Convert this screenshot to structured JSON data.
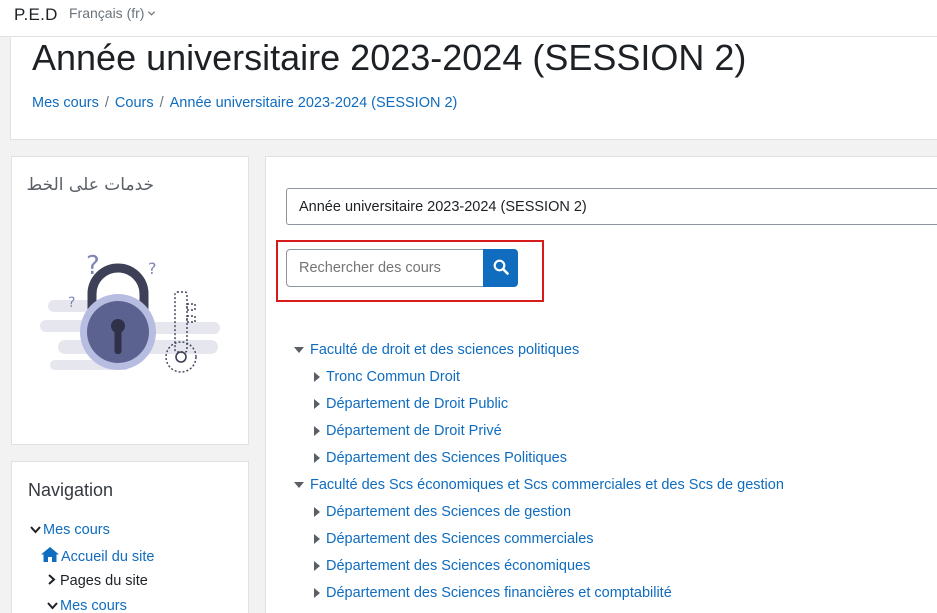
{
  "navbar": {
    "brand": "P.E.D",
    "language": "Français (fr)"
  },
  "header": {
    "title": "Année universitaire 2023-2024 (SESSION 2)",
    "breadcrumb": [
      "Mes cours",
      "Cours",
      "Année universitaire 2023-2024 (SESSION 2)"
    ]
  },
  "online_block": {
    "title": "خدمات على الخط"
  },
  "navigation": {
    "title": "Navigation",
    "items": [
      {
        "label": "Mes cours"
      },
      {
        "label": "Accueil du site"
      },
      {
        "label": "Pages du site"
      },
      {
        "label": "Mes cours"
      }
    ]
  },
  "main": {
    "category_select": "Année universitaire 2023-2024 (SESSION 2)",
    "search_placeholder": "Rechercher des cours",
    "tree": [
      {
        "label": "Faculté de droit et des sciences politiques",
        "level": 0
      },
      {
        "label": "Tronc Commun Droit",
        "level": 1
      },
      {
        "label": "Département de Droit Public",
        "level": 1
      },
      {
        "label": "Département de Droit Privé",
        "level": 1
      },
      {
        "label": "Département des Sciences Politiques",
        "level": 1
      },
      {
        "label": "Faculté des Scs économiques et Scs commerciales et des Scs de gestion",
        "level": 0
      },
      {
        "label": "Département des Sciences de gestion",
        "level": 1
      },
      {
        "label": "Département des Sciences commerciales",
        "level": 1
      },
      {
        "label": "Département des Sciences économiques",
        "level": 1
      },
      {
        "label": "Département des Sciences financières et comptabilité",
        "level": 1
      }
    ]
  },
  "colors": {
    "link": "#0f6cbf",
    "highlight": "#d71a1a",
    "button": "#0f6cbf"
  }
}
